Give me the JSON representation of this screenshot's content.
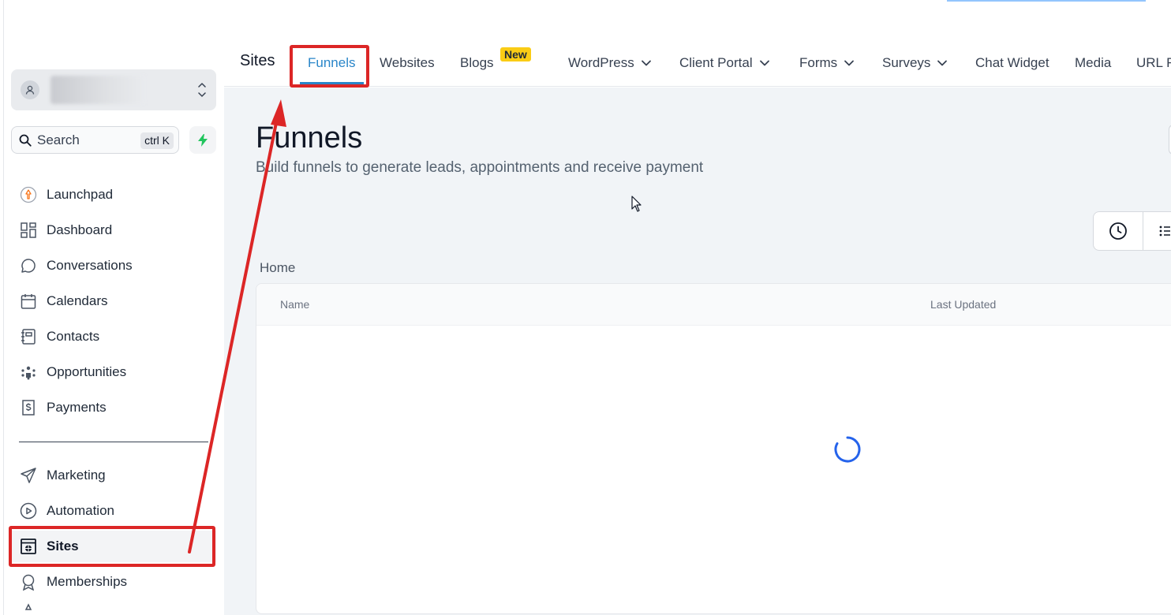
{
  "sidebar": {
    "account_switch_icon": "chevron-updown-icon",
    "search": {
      "label": "Search",
      "shortcut": "ctrl K"
    },
    "quick_action_icon": "bolt-icon",
    "items": [
      {
        "label": "Launchpad",
        "icon": "rocket-icon"
      },
      {
        "label": "Dashboard",
        "icon": "dashboard-grid-icon"
      },
      {
        "label": "Conversations",
        "icon": "chat-bubble-icon"
      },
      {
        "label": "Calendars",
        "icon": "calendar-icon"
      },
      {
        "label": "Contacts",
        "icon": "contact-book-icon"
      },
      {
        "label": "Opportunities",
        "icon": "opportunities-icon"
      },
      {
        "label": "Payments",
        "icon": "invoice-dollar-icon"
      },
      {
        "label": "Marketing",
        "icon": "paper-plane-icon"
      },
      {
        "label": "Automation",
        "icon": "play-circle-icon"
      },
      {
        "label": "Sites",
        "icon": "globe-window-icon",
        "active": true
      },
      {
        "label": "Memberships",
        "icon": "badge-icon"
      }
    ]
  },
  "topnav": {
    "section": "Sites",
    "tabs": [
      {
        "label": "Funnels",
        "active": true
      },
      {
        "label": "Websites"
      },
      {
        "label": "Blogs",
        "badge": "New"
      },
      {
        "label": "WordPress",
        "dropdown": true
      },
      {
        "label": "Client Portal",
        "dropdown": true
      },
      {
        "label": "Forms",
        "dropdown": true
      },
      {
        "label": "Surveys",
        "dropdown": true
      },
      {
        "label": "Chat Widget"
      },
      {
        "label": "Media"
      },
      {
        "label": "URL R"
      }
    ]
  },
  "main": {
    "title": "Funnels",
    "subtitle": "Build funnels to generate leads, appointments and receive payment",
    "breadcrumb": "Home",
    "table": {
      "columns": [
        "Name",
        "Last Updated"
      ],
      "loading": true
    },
    "view_toggle_icons": [
      "clock-icon",
      "list-icon"
    ]
  },
  "colors": {
    "accent": "#2a86c9",
    "annotation": "#dc2626",
    "badge": "#facc15",
    "spinner": "#2563eb",
    "bolt": "#22c55e"
  }
}
